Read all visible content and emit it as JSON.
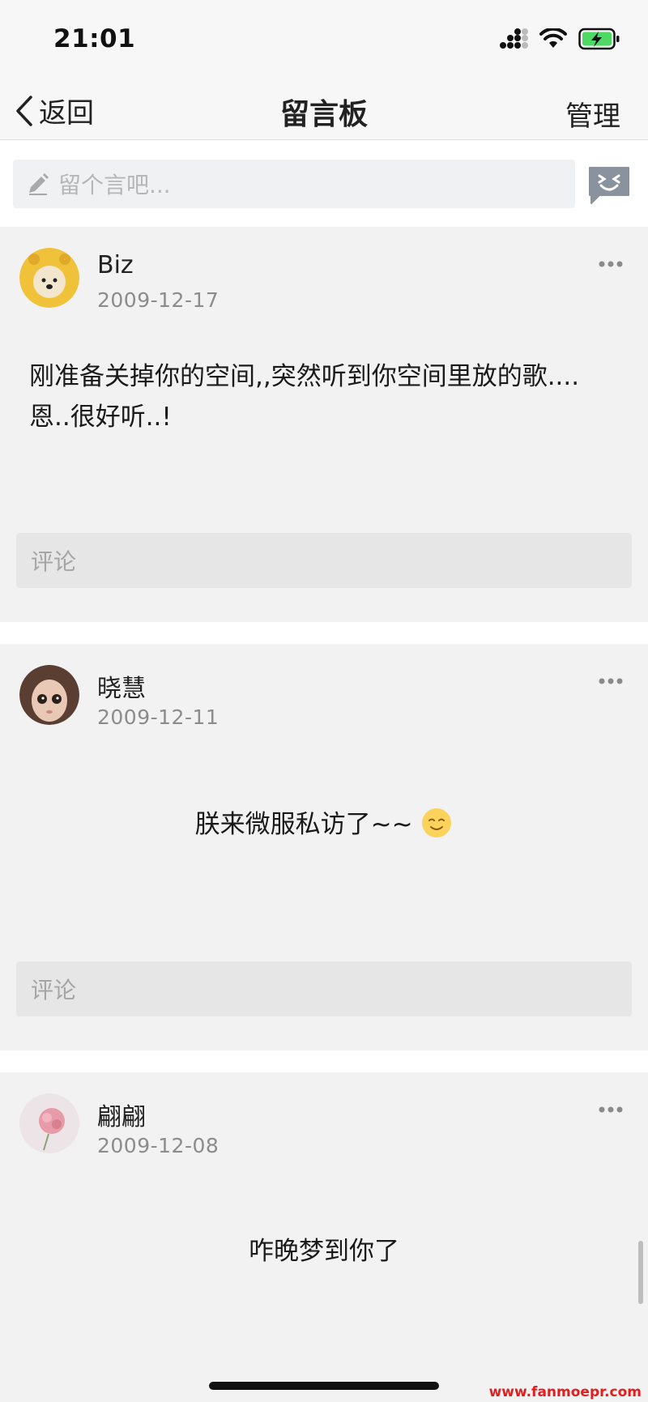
{
  "status_bar": {
    "time": "21:01"
  },
  "nav": {
    "back_label": "返回",
    "title": "留言板",
    "manage_label": "管理"
  },
  "compose": {
    "placeholder": "留个言吧..."
  },
  "posts": [
    {
      "name": "Biz",
      "date": "2009-12-17",
      "content": "刚准备关掉你的空间,,突然听到你空间里放的歌....恩..很好听..!",
      "comment_placeholder": "评论"
    },
    {
      "name": "晓慧",
      "date": "2009-12-11",
      "content": "朕来微服私访了~~",
      "comment_placeholder": "评论"
    },
    {
      "name": "翩翩",
      "date": "2009-12-08",
      "content": "咋晚梦到你了"
    }
  ],
  "watermark": "www.fanmoepr.com",
  "colors": {
    "accent_gray": "#8a929e",
    "battery_green": "#4cd964",
    "watermark_red": "#e02020"
  }
}
